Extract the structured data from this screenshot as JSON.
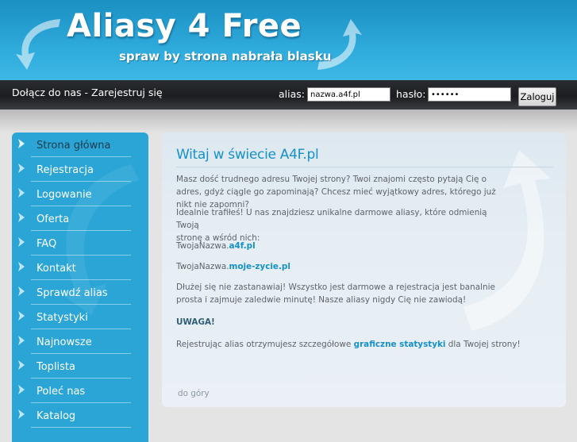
{
  "header": {
    "title": "Aliasy 4 Free",
    "tagline": "spraw by strona nabrała blasku"
  },
  "topbar": {
    "join_text": "Dołącz do nas - Zarejestruj się",
    "alias_label": "alias:",
    "alias_value": "nazwa.a4f.pl",
    "password_label": "hasło:",
    "password_value": "••••••",
    "login_button": "Zaloguj"
  },
  "sidebar": {
    "items": [
      {
        "label": "Strona główna",
        "active": true
      },
      {
        "label": "Rejestracja"
      },
      {
        "label": "Logowanie"
      },
      {
        "label": "Oferta"
      },
      {
        "label": "FAQ"
      },
      {
        "label": "Kontakt"
      },
      {
        "label": "Sprawdź alias"
      },
      {
        "label": "Statystyki"
      },
      {
        "label": "Najnowsze"
      },
      {
        "label": "Toplista"
      },
      {
        "label": "Poleć nas"
      },
      {
        "label": "Katalog"
      }
    ]
  },
  "content": {
    "title": "Witaj w świecie A4F.pl",
    "p1": "Masz dość trudnego adresu Twojej strony? Twoi znajomi często pytają Cię o adres, gdyż ciągle go zapominają? Chcesz mieć wyjątkowy adres, którego już nikt nie zapomni?",
    "p2_line1": "Idealnie trafiłeś! U nas znajdziesz unikalne darmowe aliasy, które odmienią Twoją",
    "p2_line2": "stronę a wśród nich:",
    "example1_prefix": "TwojaNazwa.",
    "example1_domain": "a4f.pl",
    "example2_prefix": "TwojaNazwa.",
    "example2_domain": "moje-zycie.pl",
    "p3": "Dłużej się nie zastanawiaj! Wszystko jest darmowe a rejestracja jest banalnie prosta i zajmuje zaledwie minutę! Nasze aliasy nigdy Cię nie zawiodą!",
    "warning": "UWAGA!",
    "p4_before": "Rejestrując alias otrzymujesz szczegółowe",
    "p4_link": "graficzne statystyki",
    "p4_after": "dla Twojej strony!",
    "back_to_top": "do góry"
  },
  "colors": {
    "header_blue": "#2eaadb",
    "sidebar_blue": "#2aa5d6",
    "link_blue": "#1591c7",
    "topbar_dark": "#1b1d20"
  },
  "icons": {
    "sidebar_bullet": "arrow-bullet-icon",
    "header_decor": "swirl-arrow-icon"
  }
}
